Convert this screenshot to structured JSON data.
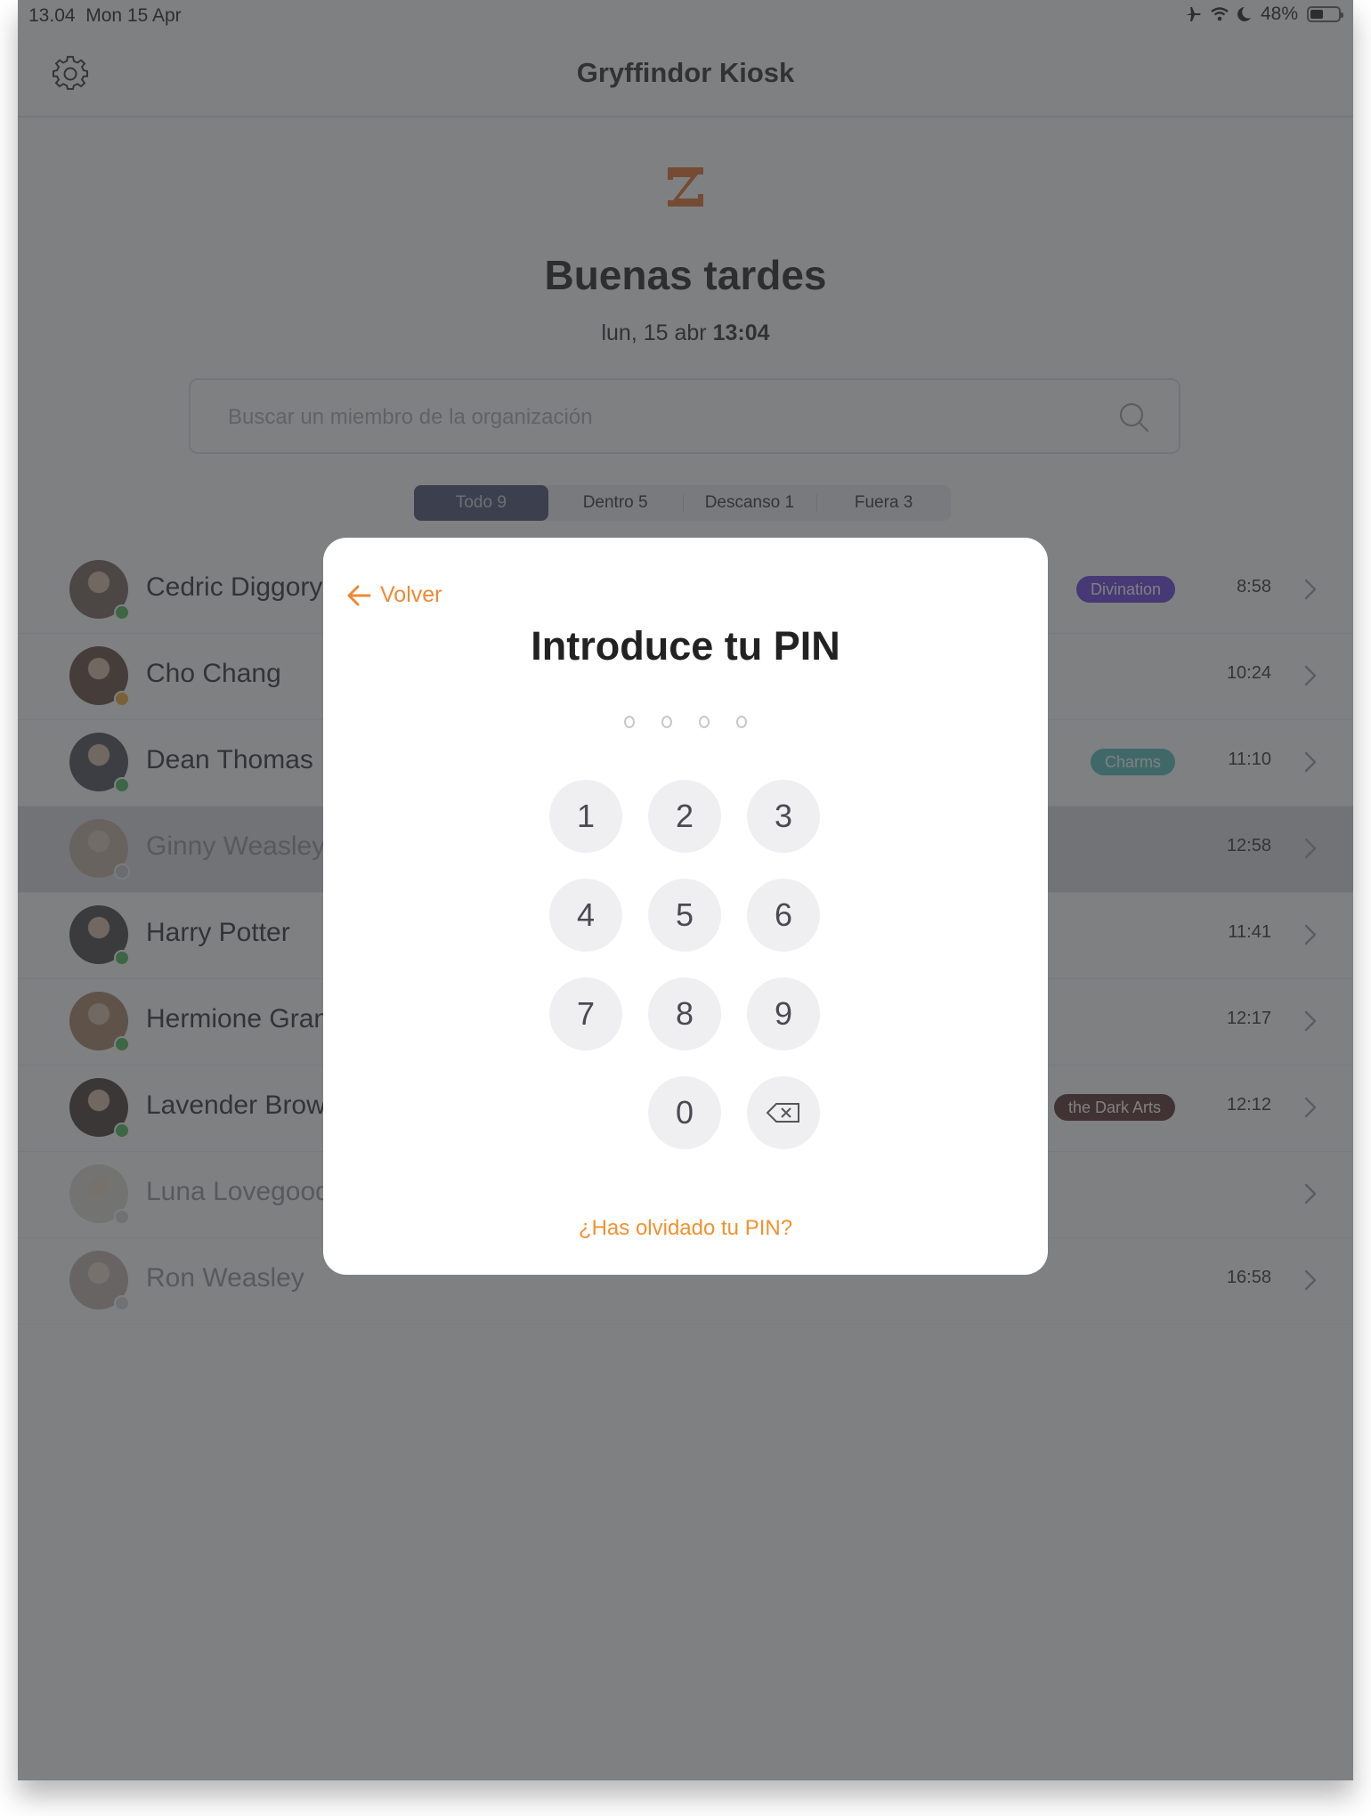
{
  "status_bar": {
    "time": "13.04",
    "date": "Mon 15 Apr",
    "battery_text": "48%",
    "battery_level": 0.48,
    "icons": [
      "airplane-icon",
      "wifi-icon",
      "moon-icon",
      "battery-icon"
    ]
  },
  "header": {
    "title": "Gryffindor Kiosk",
    "settings_icon": "gear-icon"
  },
  "hero": {
    "logo_icon": "hourglass-logo-icon",
    "greeting": "Buenas tardes",
    "date_prefix": "lun, 15 abr",
    "time": "13:04"
  },
  "search": {
    "placeholder": "Buscar un miembro de la organización",
    "value": ""
  },
  "tabs": [
    {
      "label": "Todo 9",
      "active": true
    },
    {
      "label": "Dentro 5",
      "active": false
    },
    {
      "label": "Descanso 1",
      "active": false
    },
    {
      "label": "Fuera 3",
      "active": false
    }
  ],
  "members": [
    {
      "name": "Cedric Diggory",
      "status": "in",
      "badge": "Divination",
      "badge_color": "#5b2fd9",
      "time": "8:58",
      "avatar_color": "#6b5a4a"
    },
    {
      "name": "Cho Chang",
      "status": "break",
      "badge": "",
      "badge_color": "",
      "time": "10:24",
      "avatar_color": "#5a3d30"
    },
    {
      "name": "Dean Thomas",
      "status": "in",
      "badge": "Charms",
      "badge_color": "#48b9b5",
      "time": "11:10",
      "avatar_color": "#3d3f48"
    },
    {
      "name": "Ginny Weasley",
      "status": "out",
      "badge": "",
      "badge_color": "",
      "time": "12:58",
      "avatar_color": "#b08a70",
      "highlighted": true
    },
    {
      "name": "Harry Potter",
      "status": "in",
      "badge": "",
      "badge_color": "",
      "time": "11:41",
      "avatar_color": "#3a3434"
    },
    {
      "name": "Hermione Granger",
      "status": "in",
      "badge": "",
      "badge_color": "",
      "time": "12:17",
      "avatar_color": "#a07a58"
    },
    {
      "name": "Lavender Brown",
      "status": "in",
      "badge": "Defence Against the Dark Arts",
      "badge_visible": "the Dark Arts",
      "badge_color": "#4a1c18",
      "time": "12:12",
      "avatar_color": "#3a2a24"
    },
    {
      "name": "Luna Lovegood",
      "status": "out",
      "badge": "",
      "badge_color": "",
      "time": "",
      "avatar_color": "#c7bfb2"
    },
    {
      "name": "Ron Weasley",
      "status": "out",
      "badge": "",
      "badge_color": "",
      "time": "16:58",
      "avatar_color": "#8a7868"
    }
  ],
  "status_colors": {
    "in": "#3cb34a",
    "break": "#f0a020",
    "out": "#b8b8bc"
  },
  "pin_modal": {
    "back_label": "Volver",
    "title": "Introduce tu PIN",
    "pin_length": 4,
    "pin_entered": 0,
    "keys": [
      "1",
      "2",
      "3",
      "4",
      "5",
      "6",
      "7",
      "8",
      "9",
      "",
      "0",
      "backspace"
    ],
    "forgot_label": "¿Has olvidado tu PIN?",
    "accent_color": "#f0922f"
  }
}
